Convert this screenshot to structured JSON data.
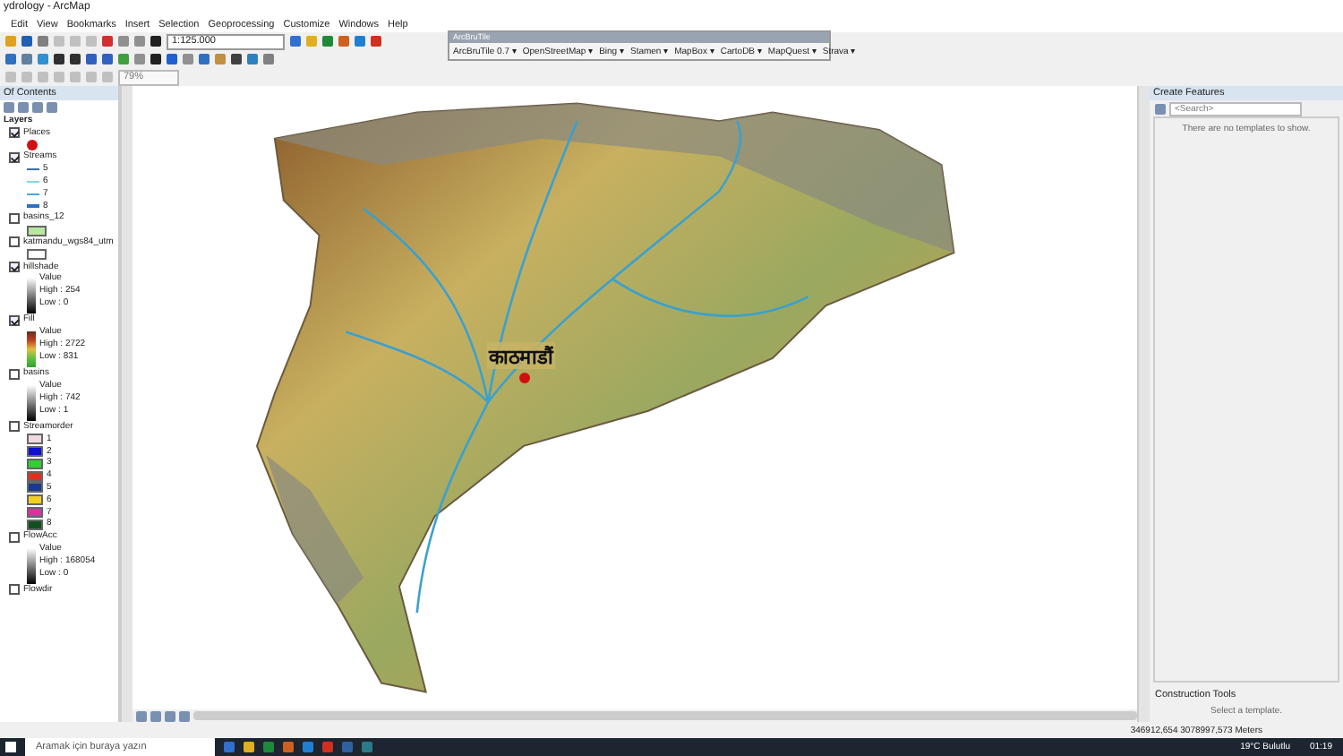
{
  "window": {
    "title": "ydrology - ArcMap"
  },
  "menu": [
    "Edit",
    "View",
    "Bookmarks",
    "Insert",
    "Selection",
    "Geoprocessing",
    "Customize",
    "Windows",
    "Help"
  ],
  "toolbar": {
    "scale": "1:125.000",
    "zoom": "79%"
  },
  "arcbrutile": {
    "title": "ArcBruTile",
    "buttons": [
      "ArcBruTile 0.7 ▾",
      "OpenStreetMap ▾",
      "Bing ▾",
      "Stamen ▾",
      "MapBox ▾",
      "CartoDB ▾",
      "MapQuest ▾",
      "Strava ▾"
    ]
  },
  "toc": {
    "title": "Of Contents",
    "root": "Layers",
    "layers": [
      {
        "name": "Places",
        "checked": true,
        "legend": {
          "kind": "point",
          "color": "#d01010"
        }
      },
      {
        "name": "Streams",
        "checked": true,
        "legend": {
          "kind": "lines",
          "entries": [
            {
              "label": "5",
              "color": "#3a6fa8"
            },
            {
              "label": "6",
              "color": "#7fd6f0"
            },
            {
              "label": "7",
              "color": "#4aa8e0"
            },
            {
              "label": "8",
              "color": "#2f6fc0"
            }
          ]
        }
      },
      {
        "name": "basins_12",
        "checked": false,
        "legend": {
          "kind": "box",
          "color": "#b8e8a0"
        }
      },
      {
        "name": "katmandu_wgs84_utm",
        "checked": false,
        "legend": {
          "kind": "box",
          "color": "#ffffff"
        }
      },
      {
        "name": "hillshade",
        "checked": true,
        "legend": {
          "kind": "gray_ramp",
          "heading": "Value",
          "high": "High : 254",
          "low": "Low : 0"
        }
      },
      {
        "name": "Fill",
        "checked": true,
        "legend": {
          "kind": "color_ramp",
          "heading": "Value",
          "high": "High : 2722",
          "low": "Low : 831"
        }
      },
      {
        "name": "basins",
        "checked": false,
        "legend": {
          "kind": "gray_ramp",
          "heading": "Value",
          "high": "High : 742",
          "low": "Low : 1"
        }
      },
      {
        "name": "Streamorder",
        "checked": false,
        "legend": {
          "kind": "classes",
          "entries": [
            {
              "label": "1",
              "color": "#f0d8e0"
            },
            {
              "label": "2",
              "color": "#1010d0"
            },
            {
              "label": "3",
              "color": "#30d030"
            },
            {
              "label": "4",
              "color": "#e03020"
            },
            {
              "label": "5",
              "color": "#1a3a90"
            },
            {
              "label": "6",
              "color": "#f0d020"
            },
            {
              "label": "7",
              "color": "#e030a0"
            },
            {
              "label": "8",
              "color": "#105020"
            }
          ]
        }
      },
      {
        "name": "FlowAcc",
        "checked": false,
        "legend": {
          "kind": "gray_ramp",
          "heading": "Value",
          "high": "High : 168054",
          "low": "Low : 0"
        }
      },
      {
        "name": "Flowdir",
        "checked": false
      }
    ]
  },
  "map": {
    "label": "काठमाडौं"
  },
  "create_features": {
    "title": "Create Features",
    "search_placeholder": "<Search>",
    "message": "There are no templates to show.",
    "construction_title": "Construction Tools",
    "construction_message": "Select a template."
  },
  "status_bar": {
    "coordinates": "346912,654  3078997,573 Meters"
  },
  "taskbar": {
    "search_placeholder": "Aramak için buraya yazın",
    "weather": "19°C Bulutlu",
    "time": "01:19"
  }
}
